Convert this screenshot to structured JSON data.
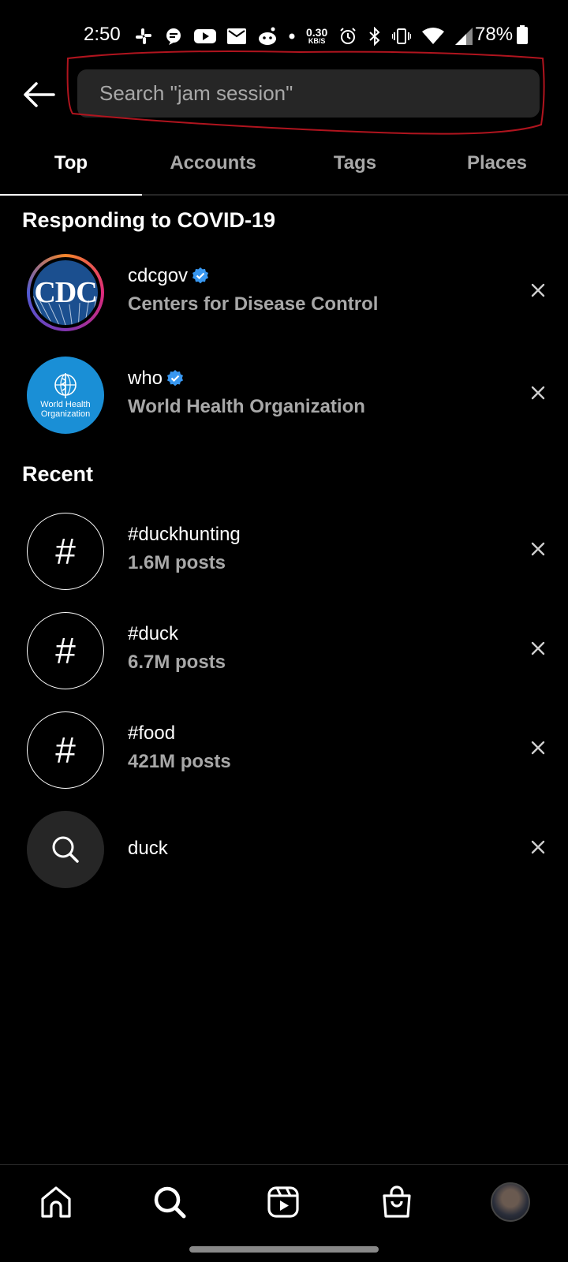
{
  "status_bar": {
    "time": "2:50",
    "net_speed_value": "0.30",
    "net_speed_unit": "KB/S",
    "battery": "78%"
  },
  "search": {
    "placeholder": "Search \"jam session\""
  },
  "tabs": [
    {
      "label": "Top",
      "active": true
    },
    {
      "label": "Accounts",
      "active": false
    },
    {
      "label": "Tags",
      "active": false
    },
    {
      "label": "Places",
      "active": false
    }
  ],
  "covid_section": {
    "title": "Responding to COVID-19",
    "accounts": [
      {
        "username": "cdcgov",
        "name": "Centers for Disease Control",
        "verified": true,
        "avatar_text": "CDC"
      },
      {
        "username": "who",
        "name": "World Health Organization",
        "verified": true,
        "avatar_text": "World Health Organization"
      }
    ]
  },
  "recent_section": {
    "title": "Recent",
    "items": [
      {
        "type": "hashtag",
        "title": "#duckhunting",
        "subtitle": "1.6M posts"
      },
      {
        "type": "hashtag",
        "title": "#duck",
        "subtitle": "6.7M posts"
      },
      {
        "type": "hashtag",
        "title": "#food",
        "subtitle": "421M posts"
      },
      {
        "type": "search",
        "title": "duck"
      }
    ]
  },
  "bottom_nav": [
    "home-icon",
    "search-icon",
    "reels-icon",
    "shop-icon",
    "profile-avatar"
  ],
  "colors": {
    "verified": "#3897f0",
    "background": "#000000",
    "search_field": "#262626",
    "annotation": "#b0141e"
  }
}
